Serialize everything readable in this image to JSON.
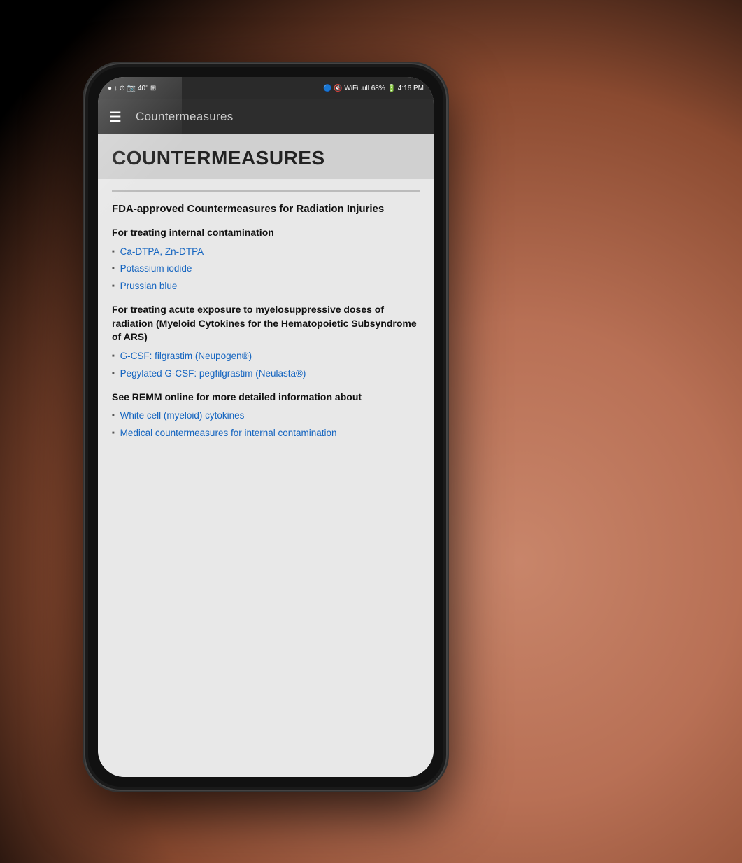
{
  "status_bar": {
    "left": "● ↕ ⊙ 📷 40° ⊞",
    "right": "🔵 🔇 WiFi .ull 68% 🔋 4:16 PM"
  },
  "app_bar": {
    "menu_icon": "☰",
    "title": "Countermeasures"
  },
  "page": {
    "heading": "COUNTERMEASURES",
    "section1": {
      "title": "FDA-approved Countermeasures for Radiation Injuries"
    },
    "subsection1": {
      "title": "For treating internal contamination",
      "items": [
        "Ca-DTPA, Zn-DTPA",
        "Potassium iodide",
        "Prussian blue"
      ]
    },
    "subsection2": {
      "title": "For treating acute exposure to myelosuppressive doses of radiation (Myeloid Cytokines for the Hematopoietic Subsyndrome of ARS)",
      "items": [
        "G-CSF: filgrastim (Neupogen®)",
        "Pegylated G-CSF: pegfilgrastim (Neulasta®)"
      ]
    },
    "subsection3": {
      "title": "See REMM online for more detailed information about",
      "items": [
        "White cell (myeloid) cytokines",
        "Medical countermeasures for internal contamination"
      ]
    }
  }
}
